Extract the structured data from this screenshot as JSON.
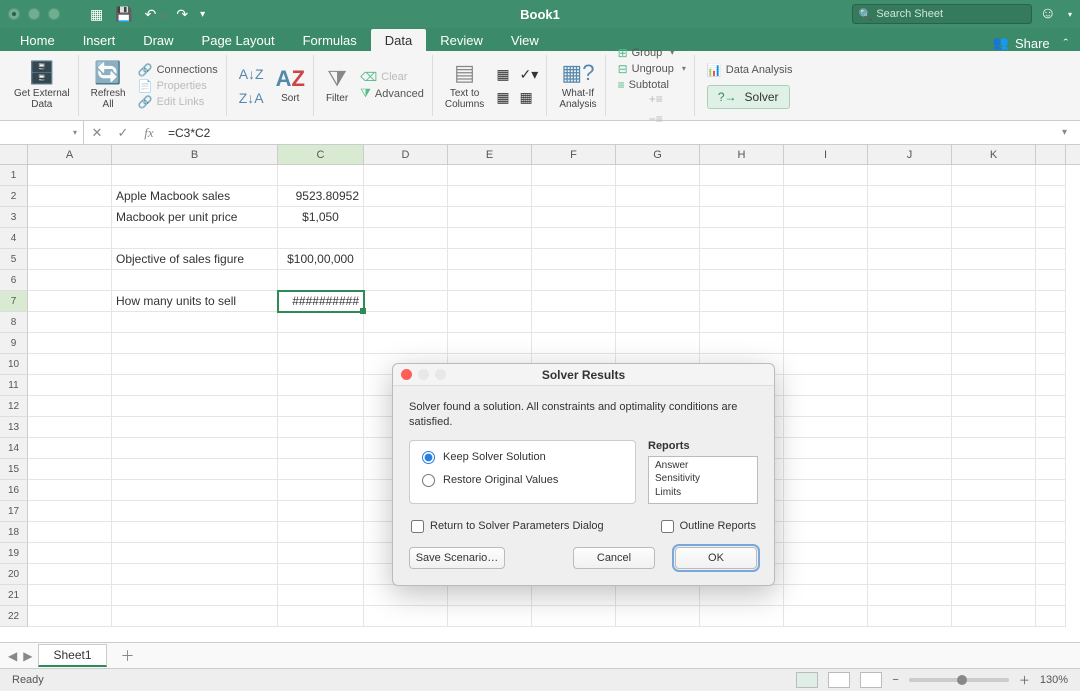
{
  "titlebar": {
    "doc_title": "Book1",
    "search_placeholder": "Search Sheet"
  },
  "tabs": {
    "items": [
      "Home",
      "Insert",
      "Draw",
      "Page Layout",
      "Formulas",
      "Data",
      "Review",
      "View"
    ],
    "active": "Data",
    "share": "Share"
  },
  "ribbon": {
    "get_external": "Get External\nData",
    "refresh": "Refresh\nAll",
    "connections": "Connections",
    "properties": "Properties",
    "edit_links": "Edit Links",
    "sort": "Sort",
    "filter": "Filter",
    "clear": "Clear",
    "advanced": "Advanced",
    "text_to_columns": "Text to\nColumns",
    "whatif": "What-If\nAnalysis",
    "group": "Group",
    "ungroup": "Ungroup",
    "subtotal": "Subtotal",
    "data_analysis": "Data Analysis",
    "solver": "Solver"
  },
  "formula_bar": {
    "name_box": "",
    "formula": "=C3*C2"
  },
  "columns": [
    "A",
    "B",
    "C",
    "D",
    "E",
    "F",
    "G",
    "H",
    "I",
    "J",
    "K"
  ],
  "active_cell": {
    "row": 7,
    "col": "C"
  },
  "cells": {
    "B2": "Apple Macbook sales",
    "C2": "9523.80952",
    "B3": "Macbook per unit price",
    "C3": "$1,050",
    "B5": "Objective of sales figure",
    "C5": "$100,00,000",
    "B7": "How many units to sell",
    "C7": "##########"
  },
  "dialog": {
    "title": "Solver Results",
    "message": "Solver found a solution.  All constraints and optimality conditions are satisfied.",
    "opt_keep": "Keep Solver Solution",
    "opt_restore": "Restore Original Values",
    "reports_label": "Reports",
    "reports": [
      "Answer",
      "Sensitivity",
      "Limits"
    ],
    "chk_return": "Return to Solver Parameters Dialog",
    "chk_outline": "Outline Reports",
    "btn_save": "Save Scenario…",
    "btn_cancel": "Cancel",
    "btn_ok": "OK"
  },
  "sheet_tabs": {
    "active": "Sheet1"
  },
  "status": {
    "ready": "Ready",
    "zoom": "130%"
  }
}
